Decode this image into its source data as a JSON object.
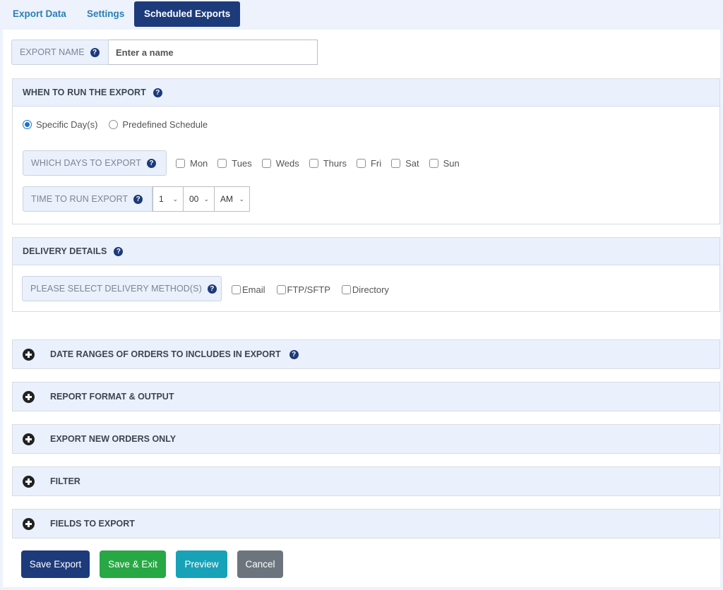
{
  "tabs": [
    {
      "label": "Export Data",
      "active": false
    },
    {
      "label": "Settings",
      "active": false
    },
    {
      "label": "Scheduled Exports",
      "active": true
    }
  ],
  "export_name": {
    "label": "EXPORT NAME",
    "help_icon": "question-circle-icon",
    "value": "",
    "placeholder": "Enter a name"
  },
  "when_to_run": {
    "title": "WHEN TO RUN THE EXPORT",
    "help_icon": "question-circle-icon",
    "schedule_options": [
      {
        "label": "Specific Day(s)",
        "selected": true
      },
      {
        "label": "Predefined Schedule",
        "selected": false
      }
    ],
    "days_label": "WHICH DAYS TO EXPORT",
    "days": [
      {
        "label": "Mon",
        "checked": false
      },
      {
        "label": "Tues",
        "checked": false
      },
      {
        "label": "Weds",
        "checked": false
      },
      {
        "label": "Thurs",
        "checked": false
      },
      {
        "label": "Fri",
        "checked": false
      },
      {
        "label": "Sat",
        "checked": false
      },
      {
        "label": "Sun",
        "checked": false
      }
    ],
    "time_label": "TIME TO RUN EXPORT",
    "time": {
      "hour": "1",
      "minute": "00",
      "meridiem": "AM"
    }
  },
  "delivery": {
    "title": "DELIVERY DETAILS",
    "help_icon": "question-circle-icon",
    "method_label": "PLEASE SELECT DELIVERY METHOD(S)",
    "methods": [
      {
        "label": "Email",
        "checked": false
      },
      {
        "label": "FTP/SFTP",
        "checked": false
      },
      {
        "label": "Directory",
        "checked": false
      }
    ]
  },
  "accordions": [
    {
      "label": "DATE RANGES OF ORDERS TO INCLUDES IN EXPORT",
      "has_help": true,
      "expanded": false
    },
    {
      "label": "REPORT FORMAT & OUTPUT",
      "has_help": false,
      "expanded": false
    },
    {
      "label": "EXPORT NEW ORDERS ONLY",
      "has_help": false,
      "expanded": false
    },
    {
      "label": "FILTER",
      "has_help": false,
      "expanded": false
    },
    {
      "label": "FIELDS TO EXPORT",
      "has_help": false,
      "expanded": false
    }
  ],
  "help_glyph": "?",
  "buttons": {
    "save_export": "Save Export",
    "save_exit": "Save & Exit",
    "preview": "Preview",
    "cancel": "Cancel"
  },
  "colors": {
    "primary": "#1d3a7b",
    "success": "#28a745",
    "info": "#17a2b8",
    "secondary": "#6c757d",
    "panel_header_bg": "#eaf1fd",
    "tab_link": "#2a7fb5"
  }
}
